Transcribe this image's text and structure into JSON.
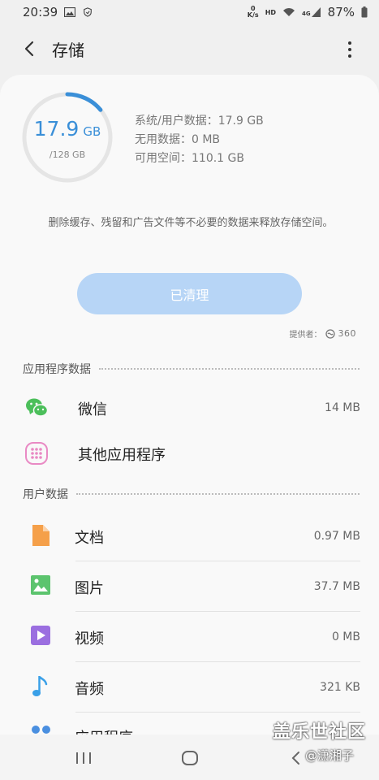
{
  "status_bar": {
    "time": "20:39",
    "speed_value": "0",
    "speed_unit": "K/s",
    "hd_label": "HD",
    "network": "4G",
    "battery": "87%"
  },
  "app_bar": {
    "title": "存储"
  },
  "storage": {
    "used_value": "17.9",
    "used_unit": "GB",
    "total": "/128 GB",
    "used_fraction": 0.14,
    "system_user_data": "系统/用户数据：17.9 GB",
    "useless_data": "无用数据：0 MB",
    "available_space": "可用空间：110.1 GB"
  },
  "cleaner": {
    "description": "删除缓存、残留和广告文件等不必要的数据来释放存储空间。",
    "button_label": "已清理",
    "provider_label": "提供者：",
    "provider_logo": "360"
  },
  "sections": {
    "app_data_title": "应用程序数据",
    "user_data_title": "用户数据"
  },
  "app_data": [
    {
      "name": "微信",
      "size": "14 MB",
      "icon": "wechat-icon"
    },
    {
      "name": "其他应用程序",
      "size": "",
      "icon": "apps-grid-icon"
    }
  ],
  "user_data": [
    {
      "name": "文档",
      "size": "0.97 MB",
      "icon": "document-icon",
      "color": "#f5a04a"
    },
    {
      "name": "图片",
      "size": "37.7 MB",
      "icon": "image-icon",
      "color": "#5cc46e"
    },
    {
      "name": "视频",
      "size": "0 MB",
      "icon": "video-icon",
      "color": "#9b6fe0"
    },
    {
      "name": "音频",
      "size": "321 KB",
      "icon": "audio-icon",
      "color": "#3aa0e8"
    },
    {
      "name": "应用程序",
      "size": "",
      "icon": "apps-icon",
      "color": "#4a8fe0"
    }
  ],
  "watermark": {
    "main": "盖乐世社区",
    "sub": "@潇湘子"
  },
  "colors": {
    "accent": "#3a8fd8",
    "button_disabled": "#b7d5f6"
  }
}
